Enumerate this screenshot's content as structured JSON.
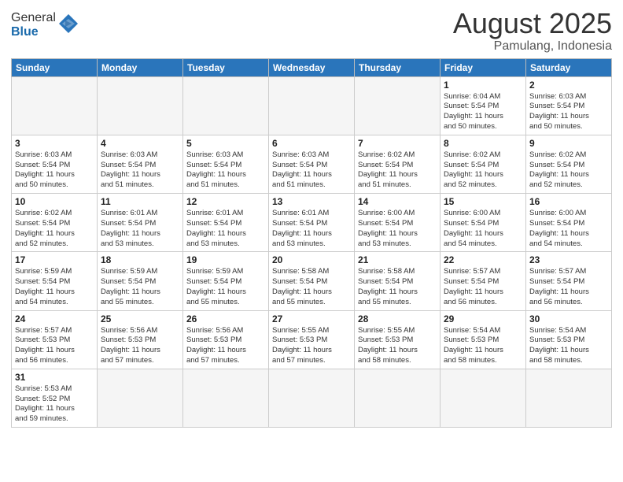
{
  "header": {
    "logo_general": "General",
    "logo_blue": "Blue",
    "month": "August 2025",
    "location": "Pamulang, Indonesia"
  },
  "weekdays": [
    "Sunday",
    "Monday",
    "Tuesday",
    "Wednesday",
    "Thursday",
    "Friday",
    "Saturday"
  ],
  "weeks": [
    [
      {
        "day": "",
        "info": ""
      },
      {
        "day": "",
        "info": ""
      },
      {
        "day": "",
        "info": ""
      },
      {
        "day": "",
        "info": ""
      },
      {
        "day": "",
        "info": ""
      },
      {
        "day": "1",
        "info": "Sunrise: 6:04 AM\nSunset: 5:54 PM\nDaylight: 11 hours\nand 50 minutes."
      },
      {
        "day": "2",
        "info": "Sunrise: 6:03 AM\nSunset: 5:54 PM\nDaylight: 11 hours\nand 50 minutes."
      }
    ],
    [
      {
        "day": "3",
        "info": "Sunrise: 6:03 AM\nSunset: 5:54 PM\nDaylight: 11 hours\nand 50 minutes."
      },
      {
        "day": "4",
        "info": "Sunrise: 6:03 AM\nSunset: 5:54 PM\nDaylight: 11 hours\nand 51 minutes."
      },
      {
        "day": "5",
        "info": "Sunrise: 6:03 AM\nSunset: 5:54 PM\nDaylight: 11 hours\nand 51 minutes."
      },
      {
        "day": "6",
        "info": "Sunrise: 6:03 AM\nSunset: 5:54 PM\nDaylight: 11 hours\nand 51 minutes."
      },
      {
        "day": "7",
        "info": "Sunrise: 6:02 AM\nSunset: 5:54 PM\nDaylight: 11 hours\nand 51 minutes."
      },
      {
        "day": "8",
        "info": "Sunrise: 6:02 AM\nSunset: 5:54 PM\nDaylight: 11 hours\nand 52 minutes."
      },
      {
        "day": "9",
        "info": "Sunrise: 6:02 AM\nSunset: 5:54 PM\nDaylight: 11 hours\nand 52 minutes."
      }
    ],
    [
      {
        "day": "10",
        "info": "Sunrise: 6:02 AM\nSunset: 5:54 PM\nDaylight: 11 hours\nand 52 minutes."
      },
      {
        "day": "11",
        "info": "Sunrise: 6:01 AM\nSunset: 5:54 PM\nDaylight: 11 hours\nand 53 minutes."
      },
      {
        "day": "12",
        "info": "Sunrise: 6:01 AM\nSunset: 5:54 PM\nDaylight: 11 hours\nand 53 minutes."
      },
      {
        "day": "13",
        "info": "Sunrise: 6:01 AM\nSunset: 5:54 PM\nDaylight: 11 hours\nand 53 minutes."
      },
      {
        "day": "14",
        "info": "Sunrise: 6:00 AM\nSunset: 5:54 PM\nDaylight: 11 hours\nand 53 minutes."
      },
      {
        "day": "15",
        "info": "Sunrise: 6:00 AM\nSunset: 5:54 PM\nDaylight: 11 hours\nand 54 minutes."
      },
      {
        "day": "16",
        "info": "Sunrise: 6:00 AM\nSunset: 5:54 PM\nDaylight: 11 hours\nand 54 minutes."
      }
    ],
    [
      {
        "day": "17",
        "info": "Sunrise: 5:59 AM\nSunset: 5:54 PM\nDaylight: 11 hours\nand 54 minutes."
      },
      {
        "day": "18",
        "info": "Sunrise: 5:59 AM\nSunset: 5:54 PM\nDaylight: 11 hours\nand 55 minutes."
      },
      {
        "day": "19",
        "info": "Sunrise: 5:59 AM\nSunset: 5:54 PM\nDaylight: 11 hours\nand 55 minutes."
      },
      {
        "day": "20",
        "info": "Sunrise: 5:58 AM\nSunset: 5:54 PM\nDaylight: 11 hours\nand 55 minutes."
      },
      {
        "day": "21",
        "info": "Sunrise: 5:58 AM\nSunset: 5:54 PM\nDaylight: 11 hours\nand 55 minutes."
      },
      {
        "day": "22",
        "info": "Sunrise: 5:57 AM\nSunset: 5:54 PM\nDaylight: 11 hours\nand 56 minutes."
      },
      {
        "day": "23",
        "info": "Sunrise: 5:57 AM\nSunset: 5:54 PM\nDaylight: 11 hours\nand 56 minutes."
      }
    ],
    [
      {
        "day": "24",
        "info": "Sunrise: 5:57 AM\nSunset: 5:53 PM\nDaylight: 11 hours\nand 56 minutes."
      },
      {
        "day": "25",
        "info": "Sunrise: 5:56 AM\nSunset: 5:53 PM\nDaylight: 11 hours\nand 57 minutes."
      },
      {
        "day": "26",
        "info": "Sunrise: 5:56 AM\nSunset: 5:53 PM\nDaylight: 11 hours\nand 57 minutes."
      },
      {
        "day": "27",
        "info": "Sunrise: 5:55 AM\nSunset: 5:53 PM\nDaylight: 11 hours\nand 57 minutes."
      },
      {
        "day": "28",
        "info": "Sunrise: 5:55 AM\nSunset: 5:53 PM\nDaylight: 11 hours\nand 58 minutes."
      },
      {
        "day": "29",
        "info": "Sunrise: 5:54 AM\nSunset: 5:53 PM\nDaylight: 11 hours\nand 58 minutes."
      },
      {
        "day": "30",
        "info": "Sunrise: 5:54 AM\nSunset: 5:53 PM\nDaylight: 11 hours\nand 58 minutes."
      }
    ],
    [
      {
        "day": "31",
        "info": "Sunrise: 5:53 AM\nSunset: 5:52 PM\nDaylight: 11 hours\nand 59 minutes."
      },
      {
        "day": "",
        "info": ""
      },
      {
        "day": "",
        "info": ""
      },
      {
        "day": "",
        "info": ""
      },
      {
        "day": "",
        "info": ""
      },
      {
        "day": "",
        "info": ""
      },
      {
        "day": "",
        "info": ""
      }
    ]
  ]
}
